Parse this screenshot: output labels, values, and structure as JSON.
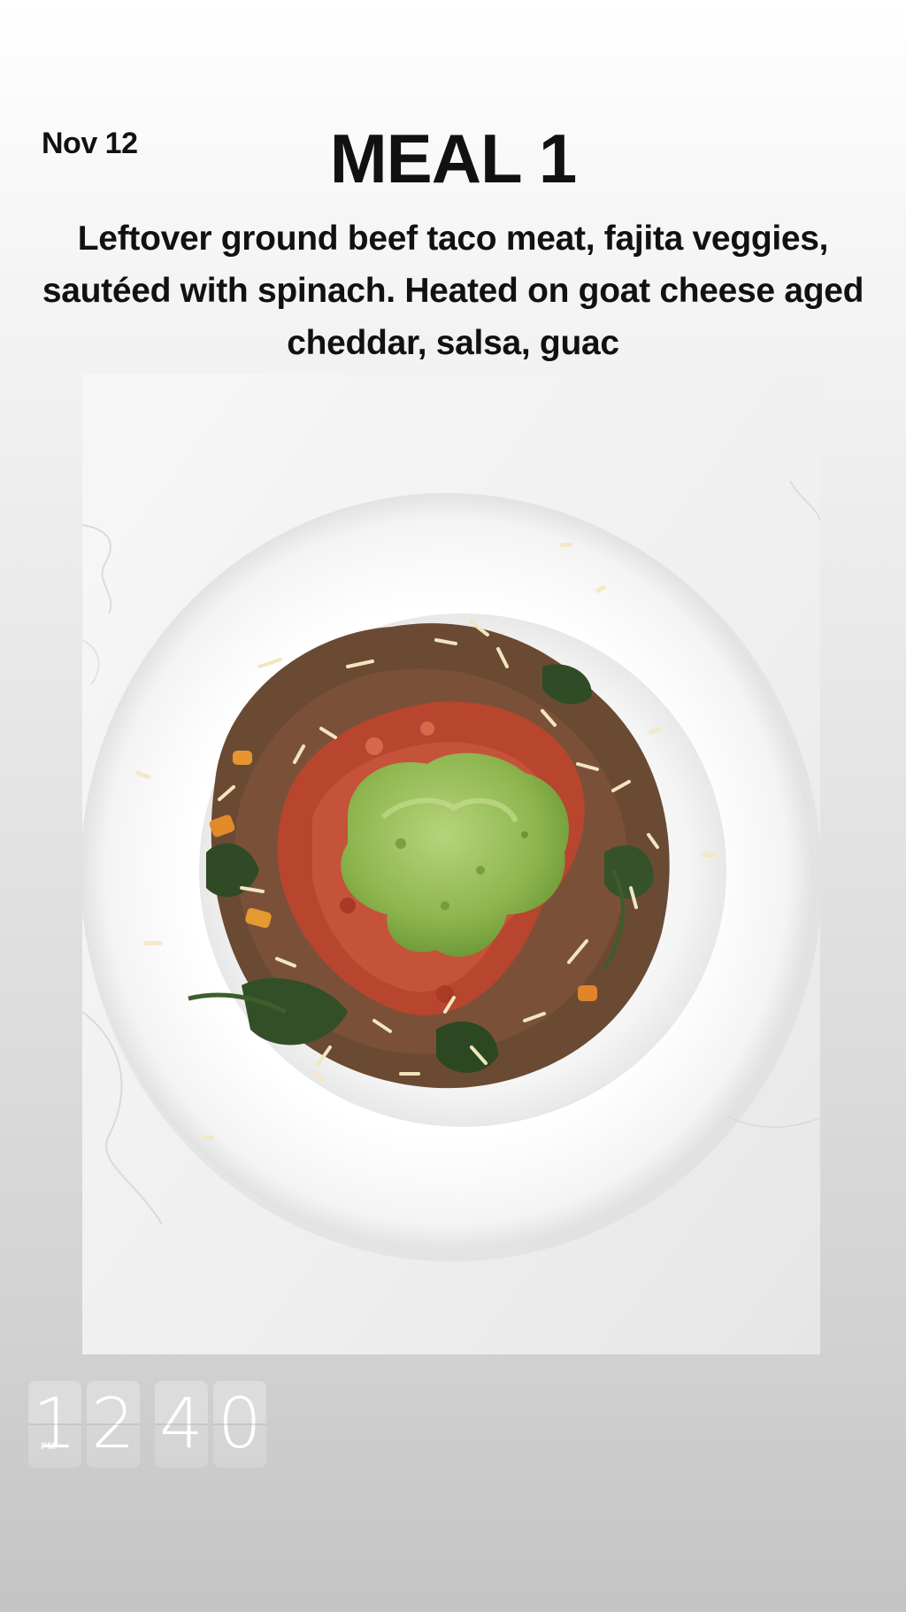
{
  "story": {
    "date": "Nov 12",
    "title": "MEAL 1",
    "description": "Leftover ground beef taco meat, fajita veggies, sautéed with spinach. Heated on goat cheese aged cheddar, salsa, guac"
  },
  "photo": {
    "subject": "plate-of-taco-meat-with-salsa-and-guacamole"
  },
  "clock_sticker": {
    "hour_digits": [
      "1",
      "2"
    ],
    "minute_digits": [
      "4",
      "0"
    ],
    "period": "PM"
  }
}
